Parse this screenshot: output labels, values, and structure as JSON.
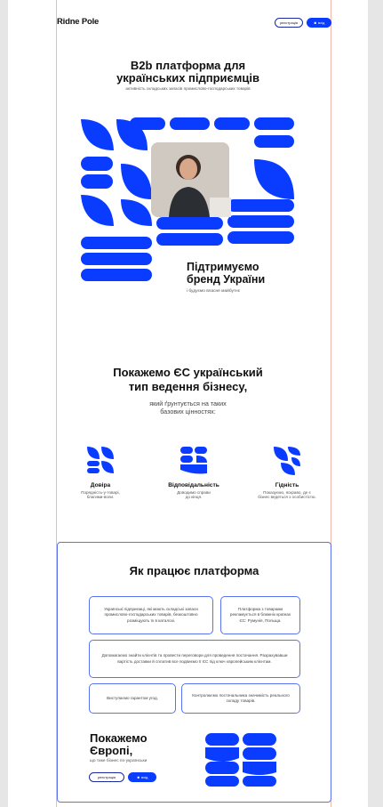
{
  "header": {
    "logo": "Ridne Pole",
    "register_label": "реєстрація",
    "login_label": "вхід"
  },
  "hero": {
    "title_line1": "B2b платформа для",
    "title_line2": "українських підприємців",
    "subtitle": "активність складських запасів промислово-господарських товарів"
  },
  "support": {
    "title_line1": "Підтримуємо",
    "title_line2": "бренд України",
    "subtitle": "і будуємо власне майбутнє"
  },
  "values_section": {
    "title_line1": "Покажемо ЄС український",
    "title_line2": "тип ведення бізнесу,",
    "subtitle_line1": "який ґрунтується на таких",
    "subtitle_line2": "базових цінностях:",
    "items": [
      {
        "icon": "trust-icon",
        "title": "Довіра",
        "line1": "Порядність-у-товарі,",
        "line2": "благими-воли."
      },
      {
        "icon": "responsibility-icon",
        "title": "Відповідальність",
        "line1": "Доводимо справи",
        "line2": "до кінця."
      },
      {
        "icon": "dignity-icon",
        "title": "Гідність",
        "line1": "Показуємо, яскраво, де є",
        "line2": "бізнес ведеться з особистістю."
      }
    ]
  },
  "how_it_works": {
    "title": "Як працює платформа",
    "cards": [
      "Українські підприємці, які мають складські запаси промислово-господарських товарів, безкоштовно розміщують їх в каталозі.",
      "Платформа з товарами рекламується в ближніх країнах ЄС: Румунія, Польща.",
      "Допомагаємо знайти клієнтів та провести переговори для проведення постачання. Разрахувавши вартість доставки й сплатив все подвиємо її ЄС під ключ європейським клієнтам.",
      "Виступаємо гарантом угод.",
      "Контролюємо постачальника значимість реального складу товарів."
    ]
  },
  "europe": {
    "title_line1": "Покажемо",
    "title_line2": "Європі,",
    "subtitle": "що таке бізнес по-українськи",
    "register_label": "реєстрація",
    "login_label": "вхід"
  },
  "colors": {
    "accent": "#0a3cff",
    "border": "#5a72f0",
    "guide": "#f2b9ad"
  }
}
